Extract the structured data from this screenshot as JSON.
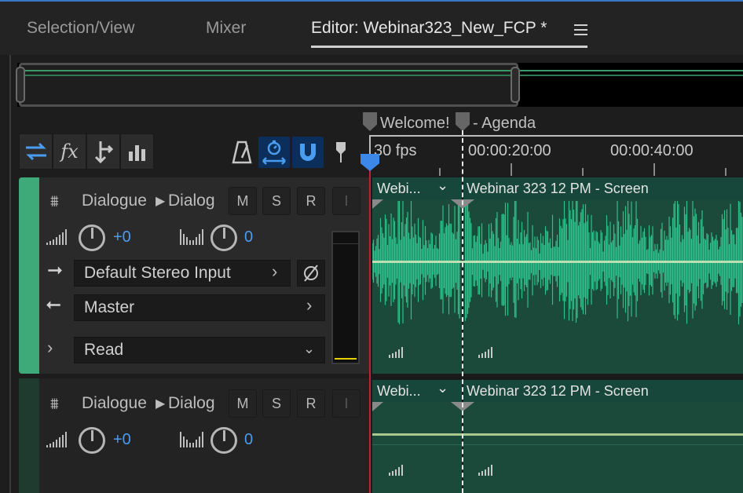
{
  "tabs": [
    {
      "label": "Selection/View"
    },
    {
      "label": "Mixer"
    },
    {
      "label": "Editor: Webinar323_New_FCP *"
    }
  ],
  "markers": [
    {
      "label": "Welcome!"
    },
    {
      "label": "- Agenda"
    }
  ],
  "ruler": {
    "fps": "30 fps",
    "times": [
      "00:00:20:00",
      "00:00:40:00"
    ]
  },
  "tracks": [
    {
      "name": "Dialogue",
      "bus": "Dialog",
      "volume": "+0",
      "pan": "0",
      "buttons": [
        "M",
        "S",
        "R",
        "I"
      ],
      "input": "Default Stereo Input",
      "output": "Master",
      "automation": "Read",
      "color": "#3eaa7a",
      "clips": [
        "Webi...",
        "Webinar 323 12 PM - Screen"
      ]
    },
    {
      "name": "Dialogue",
      "bus": "Dialog",
      "volume": "+0",
      "pan": "0",
      "buttons": [
        "M",
        "S",
        "R",
        "I"
      ],
      "color": "#1f3a2e",
      "clips": [
        "Webi...",
        "Webinar 323 12 PM - Screen"
      ]
    }
  ],
  "colors": {
    "accent": "#4a9cf0",
    "waveform": "#2ec08a",
    "clip_bg": "#1b4a3a",
    "playhead": "#c02424"
  }
}
